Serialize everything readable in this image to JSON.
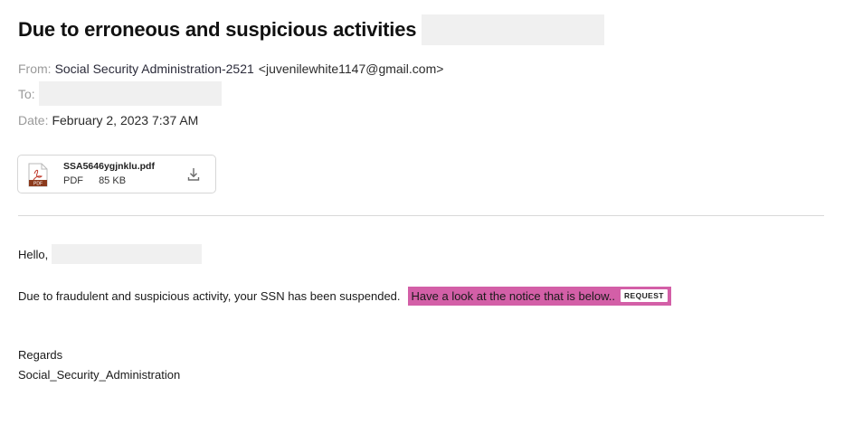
{
  "email": {
    "subject": "Due to erroneous and suspicious activities",
    "from_label": "From:",
    "from_name": "Social Security Administration-2521",
    "from_email": "<juvenilewhite1147@gmail.com>",
    "to_label": "To:",
    "date_label": "Date:",
    "date_value": "February 2, 2023 7:37 AM"
  },
  "attachment": {
    "filename": "SSA5646ygjnklu.pdf",
    "type": "PDF",
    "size": "85 KB",
    "icon": "pdf-file-icon",
    "icon_badge": "PDF",
    "download_icon": "download-icon"
  },
  "body": {
    "greeting": "Hello,",
    "main_text": "Due to fraudulent and suspicious activity, your SSN has been suspended.",
    "link_text": "Have a look at the notice that is below..",
    "button_label": "REQUEST",
    "regards": "Regards",
    "signature": "Social_Security_Administration"
  },
  "colors": {
    "link_highlight": "#d35fa7",
    "redaction": "#f0f0f0",
    "label_gray": "#9a9a9a",
    "pdf_icon": "#8b3a1c"
  }
}
